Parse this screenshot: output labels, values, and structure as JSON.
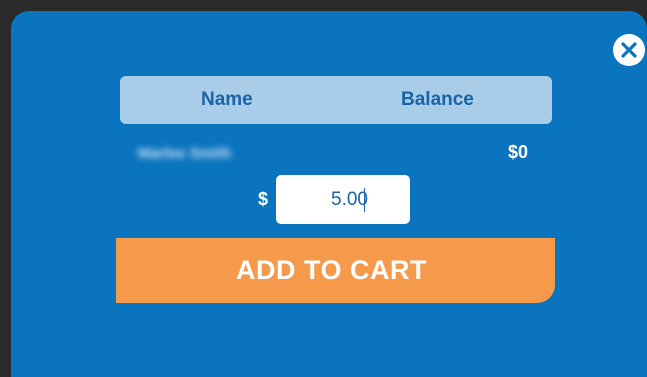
{
  "modal": {
    "close_icon": "close-icon"
  },
  "table": {
    "headers": {
      "name": "Name",
      "balance": "Balance"
    },
    "rows": [
      {
        "name": "Marlee Smith",
        "balance": "$0"
      }
    ]
  },
  "amount": {
    "currency_symbol": "$",
    "value": "5.00"
  },
  "actions": {
    "add_to_cart_label": "ADD TO CART"
  },
  "colors": {
    "modal_bg": "#0a74bf",
    "header_bg": "#a9cde8",
    "header_text": "#1a63a8",
    "button_bg": "#f5994b"
  }
}
